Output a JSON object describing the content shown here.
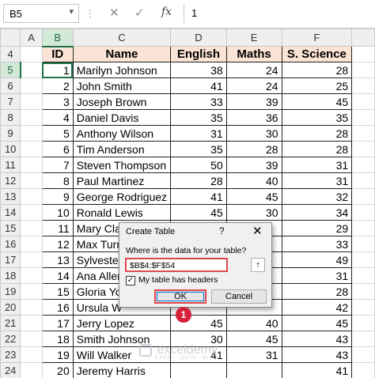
{
  "formula_bar": {
    "name_box": "B5",
    "cancel_glyph": "✕",
    "enter_glyph": "✓",
    "fx_label": "fx",
    "content": "1"
  },
  "columns": [
    "A",
    "B",
    "C",
    "D",
    "E",
    "F"
  ],
  "selected_column": "B",
  "selected_row": "5",
  "header_row": {
    "row_number": "4",
    "cells": [
      "ID",
      "Name",
      "English",
      "Maths",
      "S. Science"
    ]
  },
  "rows": [
    {
      "n": "5",
      "id": "1",
      "name": "Marilyn Johnson",
      "english": "38",
      "maths": "24",
      "sci": "28"
    },
    {
      "n": "6",
      "id": "2",
      "name": "John Smith",
      "english": "41",
      "maths": "24",
      "sci": "25"
    },
    {
      "n": "7",
      "id": "3",
      "name": "Joseph Brown",
      "english": "33",
      "maths": "39",
      "sci": "45"
    },
    {
      "n": "8",
      "id": "4",
      "name": "Daniel Davis",
      "english": "35",
      "maths": "36",
      "sci": "35"
    },
    {
      "n": "9",
      "id": "5",
      "name": "Anthony Wilson",
      "english": "31",
      "maths": "30",
      "sci": "28"
    },
    {
      "n": "10",
      "id": "6",
      "name": "Tim Anderson",
      "english": "35",
      "maths": "28",
      "sci": "28"
    },
    {
      "n": "11",
      "id": "7",
      "name": "Steven Thompson",
      "english": "50",
      "maths": "39",
      "sci": "31"
    },
    {
      "n": "12",
      "id": "8",
      "name": "Paul Martinez",
      "english": "28",
      "maths": "40",
      "sci": "31"
    },
    {
      "n": "13",
      "id": "9",
      "name": "George Rodriguez",
      "english": "41",
      "maths": "45",
      "sci": "32"
    },
    {
      "n": "14",
      "id": "10",
      "name": "Ronald Lewis",
      "english": "45",
      "maths": "30",
      "sci": "34"
    },
    {
      "n": "15",
      "id": "11",
      "name": "Mary Cla",
      "english": "",
      "maths": "",
      "sci": "29"
    },
    {
      "n": "16",
      "id": "12",
      "name": "Max Turr",
      "english": "",
      "maths": "",
      "sci": "33"
    },
    {
      "n": "17",
      "id": "13",
      "name": "Sylvester",
      "english": "",
      "maths": "",
      "sci": "49"
    },
    {
      "n": "18",
      "id": "14",
      "name": "Ana Aller",
      "english": "",
      "maths": "",
      "sci": "31"
    },
    {
      "n": "19",
      "id": "15",
      "name": "Gloria Yo",
      "english": "",
      "maths": "",
      "sci": "28"
    },
    {
      "n": "20",
      "id": "16",
      "name": "Ursula W",
      "english": "",
      "maths": "",
      "sci": "42"
    },
    {
      "n": "21",
      "id": "17",
      "name": "Jerry Lopez",
      "english": "45",
      "maths": "40",
      "sci": "45"
    },
    {
      "n": "22",
      "id": "18",
      "name": "Smith Johnson",
      "english": "30",
      "maths": "45",
      "sci": "43"
    },
    {
      "n": "23",
      "id": "19",
      "name": "Will Walker",
      "english": "41",
      "maths": "31",
      "sci": "43"
    },
    {
      "n": "24",
      "id": "20",
      "name": "Jeremy Harris",
      "english": "",
      "maths": "",
      "sci": "41"
    }
  ],
  "dialog": {
    "title": "Create Table",
    "help": "?",
    "close": "✕",
    "question": "Where is the data for your table?",
    "range_value": "$B$4:$F$54",
    "collapse_glyph": "↑",
    "checkbox_checked": "✓",
    "checkbox_label": "My table has headers",
    "ok_label": "OK",
    "cancel_label": "Cancel"
  },
  "annotation_badge": "1",
  "watermark": {
    "name": "exceldemy",
    "tagline": "EXCEL · DATA · BI"
  },
  "colors": {
    "header_fill": "#fbe4d5",
    "selection_green": "#217346",
    "highlight_red": "#e0474c",
    "badge_red": "#d6213b"
  }
}
